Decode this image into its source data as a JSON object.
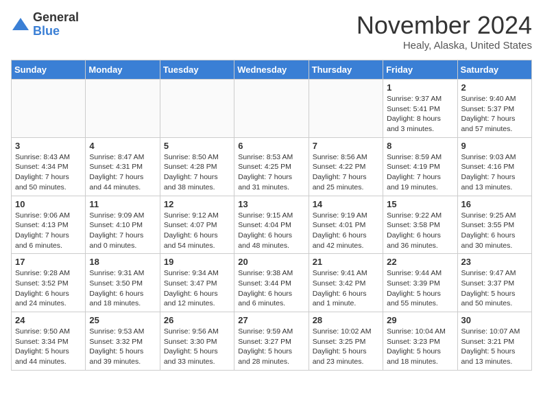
{
  "logo": {
    "general": "General",
    "blue": "Blue"
  },
  "title": "November 2024",
  "location": "Healy, Alaska, United States",
  "days_of_week": [
    "Sunday",
    "Monday",
    "Tuesday",
    "Wednesday",
    "Thursday",
    "Friday",
    "Saturday"
  ],
  "weeks": [
    [
      {
        "day": "",
        "info": ""
      },
      {
        "day": "",
        "info": ""
      },
      {
        "day": "",
        "info": ""
      },
      {
        "day": "",
        "info": ""
      },
      {
        "day": "",
        "info": ""
      },
      {
        "day": "1",
        "info": "Sunrise: 9:37 AM\nSunset: 5:41 PM\nDaylight: 8 hours\nand 3 minutes."
      },
      {
        "day": "2",
        "info": "Sunrise: 9:40 AM\nSunset: 5:37 PM\nDaylight: 7 hours\nand 57 minutes."
      }
    ],
    [
      {
        "day": "3",
        "info": "Sunrise: 8:43 AM\nSunset: 4:34 PM\nDaylight: 7 hours\nand 50 minutes."
      },
      {
        "day": "4",
        "info": "Sunrise: 8:47 AM\nSunset: 4:31 PM\nDaylight: 7 hours\nand 44 minutes."
      },
      {
        "day": "5",
        "info": "Sunrise: 8:50 AM\nSunset: 4:28 PM\nDaylight: 7 hours\nand 38 minutes."
      },
      {
        "day": "6",
        "info": "Sunrise: 8:53 AM\nSunset: 4:25 PM\nDaylight: 7 hours\nand 31 minutes."
      },
      {
        "day": "7",
        "info": "Sunrise: 8:56 AM\nSunset: 4:22 PM\nDaylight: 7 hours\nand 25 minutes."
      },
      {
        "day": "8",
        "info": "Sunrise: 8:59 AM\nSunset: 4:19 PM\nDaylight: 7 hours\nand 19 minutes."
      },
      {
        "day": "9",
        "info": "Sunrise: 9:03 AM\nSunset: 4:16 PM\nDaylight: 7 hours\nand 13 minutes."
      }
    ],
    [
      {
        "day": "10",
        "info": "Sunrise: 9:06 AM\nSunset: 4:13 PM\nDaylight: 7 hours\nand 6 minutes."
      },
      {
        "day": "11",
        "info": "Sunrise: 9:09 AM\nSunset: 4:10 PM\nDaylight: 7 hours\nand 0 minutes."
      },
      {
        "day": "12",
        "info": "Sunrise: 9:12 AM\nSunset: 4:07 PM\nDaylight: 6 hours\nand 54 minutes."
      },
      {
        "day": "13",
        "info": "Sunrise: 9:15 AM\nSunset: 4:04 PM\nDaylight: 6 hours\nand 48 minutes."
      },
      {
        "day": "14",
        "info": "Sunrise: 9:19 AM\nSunset: 4:01 PM\nDaylight: 6 hours\nand 42 minutes."
      },
      {
        "day": "15",
        "info": "Sunrise: 9:22 AM\nSunset: 3:58 PM\nDaylight: 6 hours\nand 36 minutes."
      },
      {
        "day": "16",
        "info": "Sunrise: 9:25 AM\nSunset: 3:55 PM\nDaylight: 6 hours\nand 30 minutes."
      }
    ],
    [
      {
        "day": "17",
        "info": "Sunrise: 9:28 AM\nSunset: 3:52 PM\nDaylight: 6 hours\nand 24 minutes."
      },
      {
        "day": "18",
        "info": "Sunrise: 9:31 AM\nSunset: 3:50 PM\nDaylight: 6 hours\nand 18 minutes."
      },
      {
        "day": "19",
        "info": "Sunrise: 9:34 AM\nSunset: 3:47 PM\nDaylight: 6 hours\nand 12 minutes."
      },
      {
        "day": "20",
        "info": "Sunrise: 9:38 AM\nSunset: 3:44 PM\nDaylight: 6 hours\nand 6 minutes."
      },
      {
        "day": "21",
        "info": "Sunrise: 9:41 AM\nSunset: 3:42 PM\nDaylight: 6 hours\nand 1 minute."
      },
      {
        "day": "22",
        "info": "Sunrise: 9:44 AM\nSunset: 3:39 PM\nDaylight: 5 hours\nand 55 minutes."
      },
      {
        "day": "23",
        "info": "Sunrise: 9:47 AM\nSunset: 3:37 PM\nDaylight: 5 hours\nand 50 minutes."
      }
    ],
    [
      {
        "day": "24",
        "info": "Sunrise: 9:50 AM\nSunset: 3:34 PM\nDaylight: 5 hours\nand 44 minutes."
      },
      {
        "day": "25",
        "info": "Sunrise: 9:53 AM\nSunset: 3:32 PM\nDaylight: 5 hours\nand 39 minutes."
      },
      {
        "day": "26",
        "info": "Sunrise: 9:56 AM\nSunset: 3:30 PM\nDaylight: 5 hours\nand 33 minutes."
      },
      {
        "day": "27",
        "info": "Sunrise: 9:59 AM\nSunset: 3:27 PM\nDaylight: 5 hours\nand 28 minutes."
      },
      {
        "day": "28",
        "info": "Sunrise: 10:02 AM\nSunset: 3:25 PM\nDaylight: 5 hours\nand 23 minutes."
      },
      {
        "day": "29",
        "info": "Sunrise: 10:04 AM\nSunset: 3:23 PM\nDaylight: 5 hours\nand 18 minutes."
      },
      {
        "day": "30",
        "info": "Sunrise: 10:07 AM\nSunset: 3:21 PM\nDaylight: 5 hours\nand 13 minutes."
      }
    ]
  ]
}
